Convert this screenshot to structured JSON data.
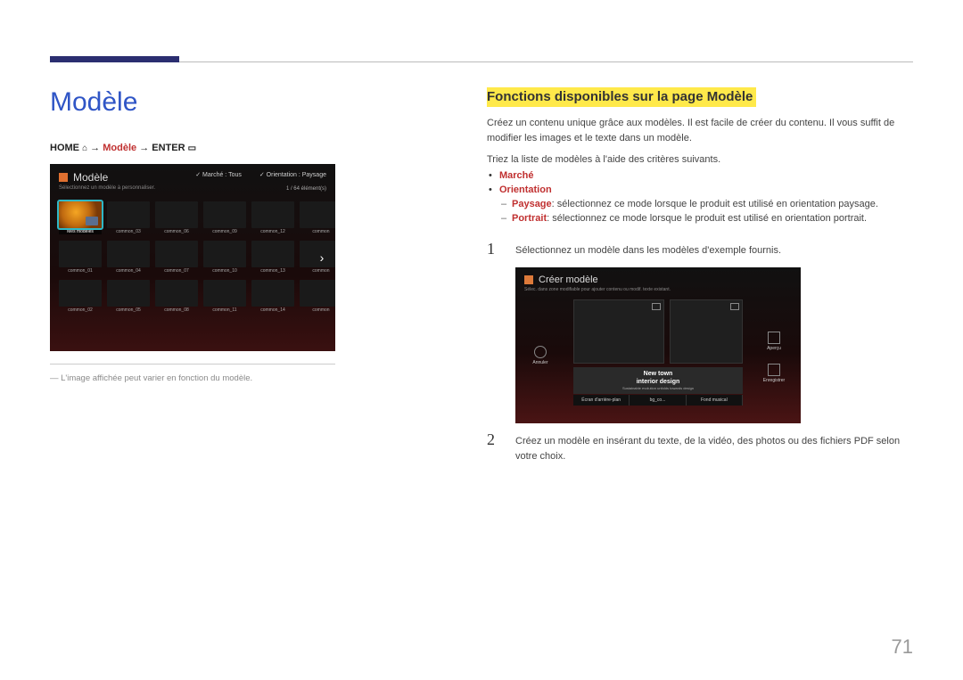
{
  "left": {
    "title": "Modèle",
    "breadcrumb": {
      "home": "HOME",
      "arrow1": "→",
      "modele": "Modèle",
      "arrow2": "→",
      "enter": "ENTER"
    },
    "footnote": "L'image affichée peut varier en fonction du modèle."
  },
  "template_screen": {
    "title": "Modèle",
    "subtitle": "Sélectionnez un modèle à personnaliser.",
    "filter_marche": "Marché : Tous",
    "filter_orientation": "Orientation : Paysage",
    "count": "1 / 64 élément(s)",
    "cells": [
      "Mes modèles",
      "common_03",
      "common_06",
      "common_09",
      "common_12",
      "common",
      "common_01",
      "common_04",
      "common_07",
      "common_10",
      "common_13",
      "common",
      "common_02",
      "common_05",
      "common_08",
      "common_11",
      "common_14",
      "common"
    ]
  },
  "right": {
    "section_title": "Fonctions disponibles sur la page Modèle",
    "para1": "Créez un contenu unique grâce aux modèles. Il est facile de créer du contenu. Il vous suffit de modifier les images et le texte dans un modèle.",
    "sort_intro": "Triez la liste de modèles à l'aide des critères suivants.",
    "bullet_marche": "Marché",
    "bullet_orientation": "Orientation",
    "sub_paysage_label": "Paysage",
    "sub_paysage_text": ": sélectionnez ce mode lorsque le produit est utilisé en orientation paysage.",
    "sub_portrait_label": "Portrait",
    "sub_portrait_text": ": sélectionnez ce mode lorsque le produit est utilisé en orientation portrait.",
    "step1_num": "1",
    "step1_text": "Sélectionnez un modèle dans les modèles d'exemple fournis.",
    "step2_num": "2",
    "step2_text": "Créez un modèle en insérant du texte, de la vidéo, des photos ou des fichiers PDF selon votre choix."
  },
  "create_screen": {
    "title": "Créer modèle",
    "subtitle": "Sélec. dans zone modifiable pour ajouter contenu ou modif. texte existant.",
    "text_line1": "New town",
    "text_line2": "interior design",
    "text_line3": "Sustainable evolution unfolds towards design",
    "tabs": [
      "Écran d'arrière-plan",
      "bg_co...",
      "Fond musical"
    ],
    "annuler": "Annuler",
    "apercu": "Aperçu",
    "enregistrer": "Enregistrer"
  },
  "page_number": "71"
}
